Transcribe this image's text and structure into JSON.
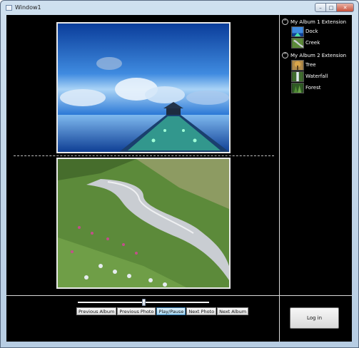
{
  "window": {
    "title": "Window1",
    "min_glyph": "–",
    "max_glyph": "□",
    "close_glyph": "✕"
  },
  "albums": [
    {
      "title": "My Album 1 Extension",
      "expander": "^",
      "photos": [
        {
          "label": "Dock",
          "thumb": "dock-thumb"
        },
        {
          "label": "Creek",
          "thumb": "creek-thumb"
        }
      ]
    },
    {
      "title": "My Album 2 Extension",
      "expander": "^",
      "photos": [
        {
          "label": "Tree",
          "thumb": "tree-thumb"
        },
        {
          "label": "Waterfall",
          "thumb": "waterfall-thumb"
        },
        {
          "label": "Forest",
          "thumb": "forest-thumb"
        }
      ]
    }
  ],
  "viewer": {
    "top_photo": "Dock",
    "bottom_photo": "Creek"
  },
  "slider": {
    "value_fraction": 0.5
  },
  "controls": {
    "previous_album": "Previous Album",
    "previous_photo": "Previous Photo",
    "play_pause": "Play/Pause",
    "next_photo": "Next Photo",
    "next_album": "Next Album"
  },
  "login": {
    "label": "Log in"
  },
  "colors": {
    "background": "#000000",
    "accent": "#a9d8f2",
    "sky": "#1f5fb8",
    "grass": "#5c8a3a"
  }
}
